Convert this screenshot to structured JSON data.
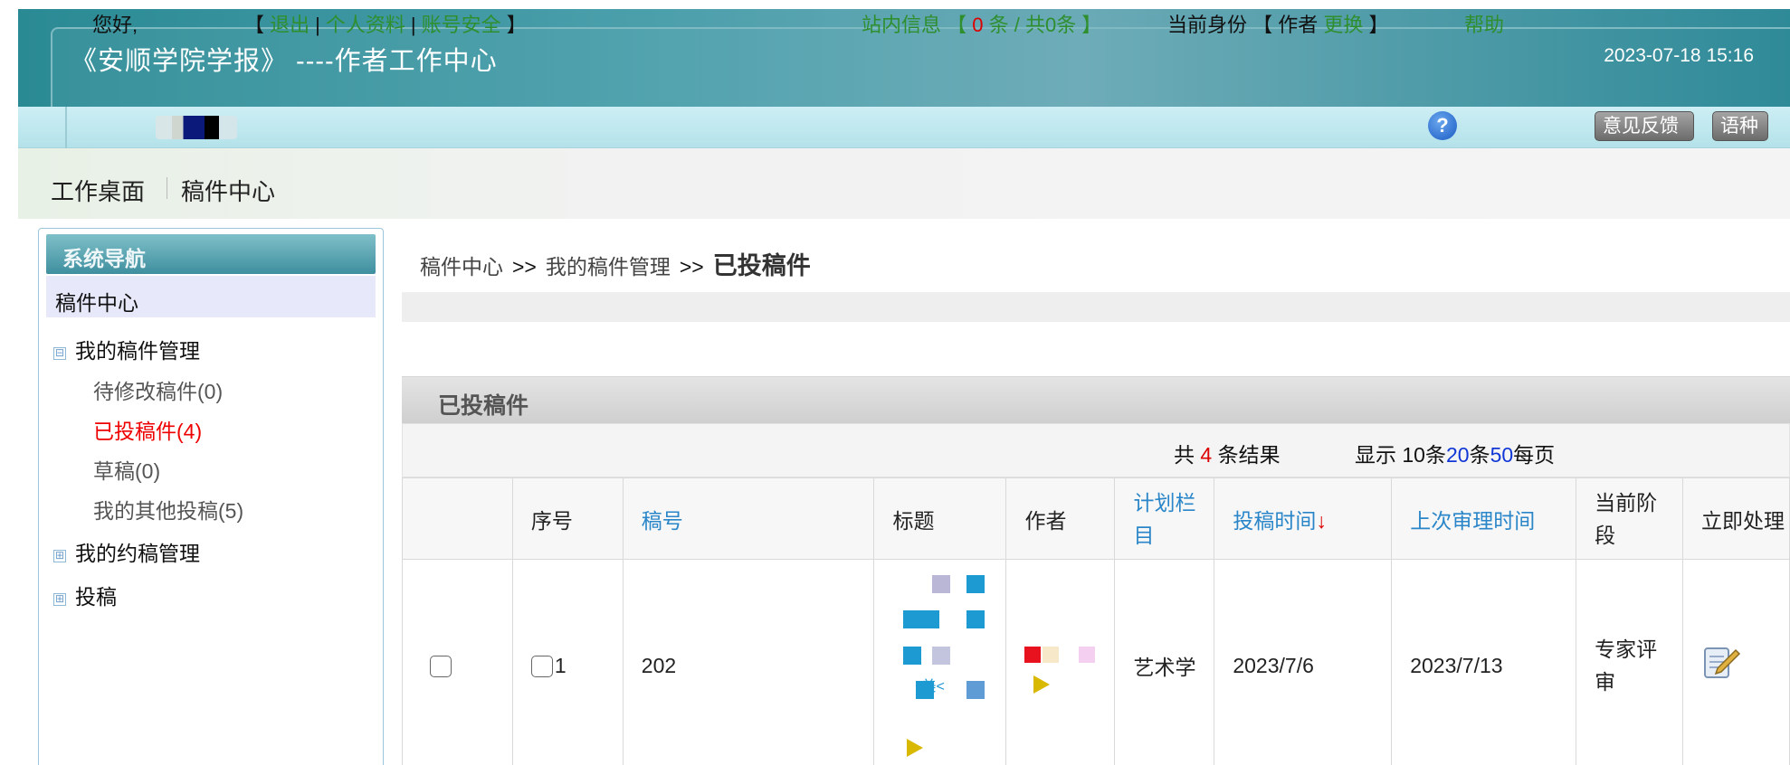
{
  "header": {
    "title": "《安顺学院学报》 ----作者工作中心",
    "datetime": "2023-07-18 15:16"
  },
  "infobar": {
    "greeting": "您好,",
    "bracket_open": "【",
    "bracket_close": "】",
    "links": [
      "退出",
      "个人资料",
      "账号安全"
    ],
    "msg_label": "站内信息 【",
    "msg_count": "0",
    "msg_suffix": "条 / 共0条 】",
    "role_label": "当前身份 【 作者",
    "role_switch": "更换",
    "role_close": "】",
    "help_icon_glyph": "?",
    "help": "帮助",
    "feedback_button": "意见反馈",
    "language_button": "语种"
  },
  "topnav": {
    "items": [
      "工作桌面",
      "稿件中心"
    ]
  },
  "sidebar": {
    "heading": "系统导航",
    "selected": "稿件中心",
    "tree_collapse_glyph": "⊟",
    "tree_expand_glyph": "⊞",
    "tree": [
      {
        "label": "我的稿件管理",
        "expanded": true
      },
      {
        "label": "我的约稿管理",
        "expanded": false
      },
      {
        "label": "投稿",
        "expanded": false
      }
    ],
    "sub_items": [
      "待修改稿件(0)",
      "已投稿件(4)",
      "草稿(0)",
      "我的其他投稿(5)"
    ]
  },
  "breadcrumb": {
    "items": [
      "稿件中心",
      "我的稿件管理",
      "已投稿件"
    ],
    "separator": ">>"
  },
  "panel": {
    "title": "已投稿件"
  },
  "summary": {
    "prefix": "共",
    "count": "4",
    "suffix": "条结果",
    "display_prefix": "显示 10条",
    "opt20": "20",
    "mid": "条",
    "opt50": "50",
    "display_suffix": "每页"
  },
  "table": {
    "headers": [
      "",
      "序号",
      "稿号",
      "标题",
      "作者",
      "计划栏目",
      "投稿时间",
      "上次审理时间",
      "当前阶段",
      "立即处理"
    ],
    "sort_arrow": "↓",
    "rows": [
      {
        "index": "1",
        "manuscript_no": "202",
        "title_fragment": "美<",
        "column": "艺术学",
        "submitted": "2023/7/6",
        "last_reviewed": "2023/7/13",
        "stage": "专家评审"
      }
    ]
  },
  "colors": {
    "header_teal": "#2a8a94",
    "link_green": "#2f8f2f",
    "link_blue": "#2a86c8",
    "active_red": "#e00000"
  },
  "icons": [
    "help-icon",
    "edit-icon",
    "checkbox-icon",
    "tree-toggle-icon"
  ]
}
